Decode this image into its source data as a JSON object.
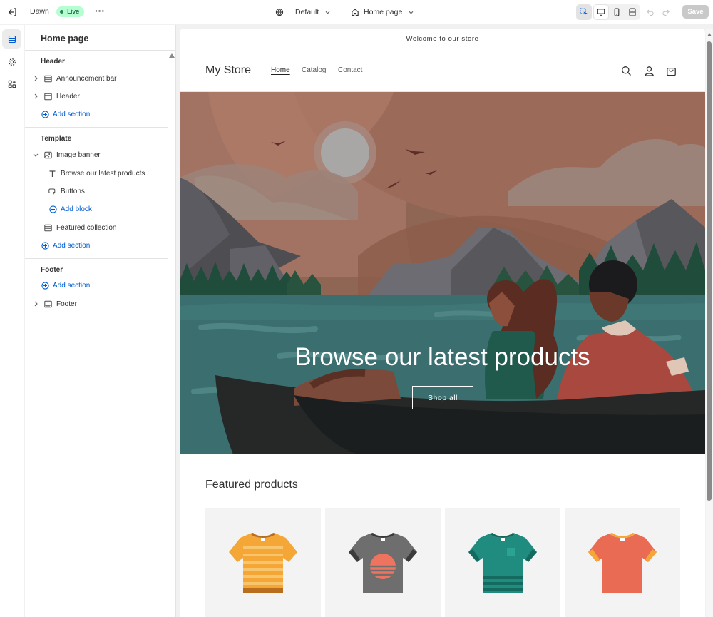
{
  "topbar": {
    "theme_name": "Dawn",
    "live_badge": "Live",
    "template_dropdown": "Default",
    "page_dropdown": "Home page",
    "save_label": "Save"
  },
  "sidebar": {
    "title": "Home page",
    "header_group": {
      "label": "Header",
      "items": [
        {
          "label": "Announcement bar"
        },
        {
          "label": "Header"
        }
      ],
      "add_label": "Add section"
    },
    "template_group": {
      "label": "Template",
      "items": [
        {
          "label": "Image banner"
        },
        {
          "label": "Browse our latest products"
        },
        {
          "label": "Buttons"
        },
        {
          "label": "Featured collection"
        }
      ],
      "add_block_label": "Add block",
      "add_label": "Add section"
    },
    "footer_group": {
      "label": "Footer",
      "add_label": "Add section",
      "items": [
        {
          "label": "Footer"
        }
      ]
    }
  },
  "store": {
    "announcement": "Welcome to our store",
    "logo": "My Store",
    "nav": [
      {
        "label": "Home"
      },
      {
        "label": "Catalog"
      },
      {
        "label": "Contact"
      }
    ],
    "banner_heading": "Browse our latest products",
    "banner_button": "Shop all",
    "featured_title": "Featured products"
  },
  "colors": {
    "accent_blue": "#005bd3",
    "live_bg": "#b4fed2",
    "banner_sky": "#8f6654",
    "banner_water": "#3b6f6f"
  },
  "icons": [
    "exit-icon",
    "more-icon",
    "globe-icon",
    "home-icon",
    "chevron-down-icon",
    "inspector-icon",
    "desktop-icon",
    "mobile-icon",
    "fullscreen-icon",
    "undo-icon",
    "redo-icon",
    "sections-icon",
    "settings-icon",
    "apps-icon",
    "search-icon",
    "account-icon",
    "cart-icon",
    "plus-circle-icon",
    "text-icon",
    "button-icon",
    "image-icon",
    "layout-icon"
  ]
}
